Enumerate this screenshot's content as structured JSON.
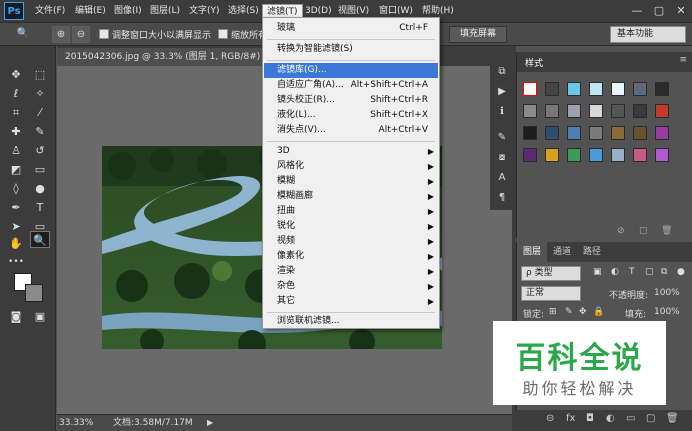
{
  "app": {
    "logo": "Ps"
  },
  "menu": [
    "文件(F)",
    "编辑(E)",
    "图像(I)",
    "图层(L)",
    "文字(Y)",
    "选择(S)",
    "滤镜(T)",
    "3D(D)",
    "视图(V)",
    "窗口(W)",
    "帮助(H)"
  ],
  "window_controls": [
    "—",
    "▢",
    "✕"
  ],
  "options": {
    "resize_window": "调整窗口大小以满屏显示",
    "zoom_all": "缩放所有",
    "fill_screen": "填充屏幕",
    "workspace": "基本功能"
  },
  "document": {
    "tab_title": "2015042306.jpg @ 33.3% (图层 1, RGB/8#) *",
    "zoom": "33.33%",
    "doc_size": "文档:3.58M/7.17M"
  },
  "filter_menu": {
    "items": [
      {
        "label": "玻璃",
        "shortcut": "Ctrl+F"
      },
      {
        "label": "转换为智能滤镜(S)"
      },
      {
        "label": "滤镜库(G)...",
        "highlighted": true
      },
      {
        "label": "自适应广角(A)...",
        "shortcut": "Alt+Shift+Ctrl+A"
      },
      {
        "label": "镜头校正(R)...",
        "shortcut": "Shift+Ctrl+R"
      },
      {
        "label": "液化(L)...",
        "shortcut": "Shift+Ctrl+X"
      },
      {
        "label": "消失点(V)...",
        "shortcut": "Alt+Ctrl+V"
      },
      {
        "label": "3D",
        "submenu": true
      },
      {
        "label": "风格化",
        "submenu": true
      },
      {
        "label": "模糊",
        "submenu": true
      },
      {
        "label": "模糊画廊",
        "submenu": true
      },
      {
        "label": "扭曲",
        "submenu": true
      },
      {
        "label": "锐化",
        "submenu": true
      },
      {
        "label": "视频",
        "submenu": true
      },
      {
        "label": "像素化",
        "submenu": true
      },
      {
        "label": "渲染",
        "submenu": true
      },
      {
        "label": "杂色",
        "submenu": true
      },
      {
        "label": "其它",
        "submenu": true
      },
      {
        "label": "浏览联机滤镜..."
      }
    ]
  },
  "styles_panel": {
    "title": "样式"
  },
  "layers_panel": {
    "tabs": [
      "图层",
      "通道",
      "路径"
    ],
    "filter_kind": "ρ 类型",
    "blend_mode": "正常",
    "opacity_label": "不透明度:",
    "opacity_value": "100%",
    "lock_label": "锁定:",
    "fill_label": "填充:",
    "fill_value": "100%"
  },
  "watermark": {
    "big": "百科全说",
    "small": "助你轻松解决"
  }
}
